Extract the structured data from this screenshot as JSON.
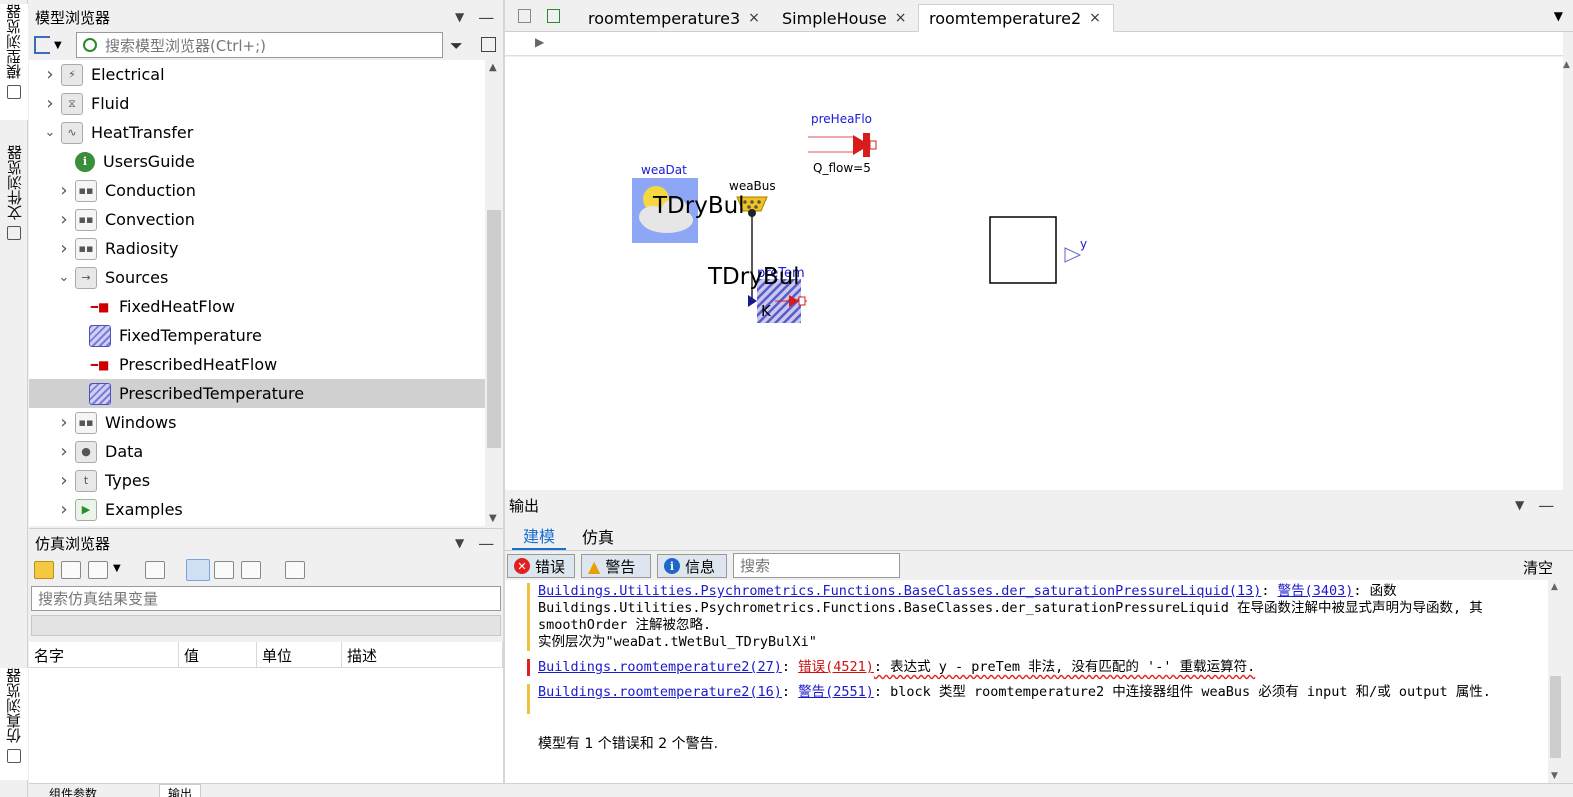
{
  "model_browser": {
    "title": "模型浏览器",
    "search_placeholder": "搜索模型浏览器(Ctrl+;)",
    "tree": [
      {
        "label": "Electrical",
        "depth": 0,
        "expanded": false,
        "icon": "electrical-icon"
      },
      {
        "label": "Fluid",
        "depth": 0,
        "expanded": false,
        "icon": "fluid-icon"
      },
      {
        "label": "HeatTransfer",
        "depth": 0,
        "expanded": true,
        "icon": "heattransfer-icon"
      },
      {
        "label": "UsersGuide",
        "depth": 1,
        "expanded": null,
        "icon": "info-icon"
      },
      {
        "label": "Conduction",
        "depth": 1,
        "expanded": false,
        "icon": "package-icon"
      },
      {
        "label": "Convection",
        "depth": 1,
        "expanded": false,
        "icon": "package-icon"
      },
      {
        "label": "Radiosity",
        "depth": 1,
        "expanded": false,
        "icon": "package-icon"
      },
      {
        "label": "Sources",
        "depth": 1,
        "expanded": true,
        "icon": "sources-icon"
      },
      {
        "label": "FixedHeatFlow",
        "depth": 2,
        "expanded": null,
        "icon": "heatflow-icon"
      },
      {
        "label": "FixedTemperature",
        "depth": 2,
        "expanded": null,
        "icon": "temperature-icon"
      },
      {
        "label": "PrescribedHeatFlow",
        "depth": 2,
        "expanded": null,
        "icon": "heatflow-icon"
      },
      {
        "label": "PrescribedTemperature",
        "depth": 2,
        "expanded": null,
        "icon": "temperature-icon",
        "selected": true
      },
      {
        "label": "Windows",
        "depth": 1,
        "expanded": false,
        "icon": "package-icon"
      },
      {
        "label": "Data",
        "depth": 1,
        "expanded": false,
        "icon": "data-icon"
      },
      {
        "label": "Types",
        "depth": 1,
        "expanded": false,
        "icon": "types-icon"
      },
      {
        "label": "Examples",
        "depth": 1,
        "expanded": false,
        "icon": "examples-icon"
      }
    ]
  },
  "side_tabs": {
    "model_browser": "模型浏览器",
    "file_browser": "文件浏览器",
    "sim_browser": "仿真浏览器"
  },
  "sim_browser": {
    "title": "仿真浏览器",
    "search_placeholder": "搜索仿真结果变量",
    "columns": [
      "名字",
      "值",
      "单位",
      "描述"
    ]
  },
  "editor": {
    "tabs": [
      {
        "label": "roomtemperature3",
        "close": "×",
        "active": false
      },
      {
        "label": "SimpleHouse",
        "close": "×",
        "active": false
      },
      {
        "label": "roomtemperature2",
        "close": "×",
        "active": true
      }
    ],
    "menu_icon": "▼"
  },
  "diagram": {
    "preHeaFlo_label": "preHeaFlo",
    "q_flow_label": "Q_flow=5",
    "weaDat_label": "weaDat",
    "weaBus_label": "weaBus",
    "tdrybul_overlay_1": "TDryBul",
    "tdrybul_overlay_2": "TDryBul",
    "preTem_label": "preTem",
    "k_label": "K",
    "y_label": "y"
  },
  "output": {
    "title": "输出",
    "tabs": [
      "建模",
      "仿真"
    ],
    "active_tab": "建模",
    "filters": {
      "error": "错误",
      "warning": "警告",
      "info": "信息"
    },
    "search_placeholder": "搜索",
    "clear": "清空",
    "entries": [
      {
        "type": "warning",
        "link": "Buildings.Utilities.Psychrometrics.Functions.BaseClasses.der_saturationPressureLiquid(13)",
        "code": "警告(3403)",
        "line1_tail": ": 函数",
        "line2": "Buildings.Utilities.Psychrometrics.Functions.BaseClasses.der_saturationPressureLiquid 在导函数注解中被显式声明为导函数, 其",
        "line3": "smoothOrder 注解被忽略.",
        "line4": "实例层次为\"weaDat.tWetBul_TDryBulXi\""
      },
      {
        "type": "error",
        "link": "Buildings.roomtemperature2(27)",
        "code": "错误(4521)",
        "text": ": 表达式 y - preTem 非法, 没有匹配的 '-' 重载运算符."
      },
      {
        "type": "warning",
        "link": "Buildings.roomtemperature2(16)",
        "code": "警告(2551)",
        "text": ": block 类型 roomtemperature2 中连接器组件 weaBus 必须有 input 和/或 output 属性."
      }
    ],
    "summary": "模型有 1 个错误和 2 个警告."
  },
  "status_tabs": [
    "组件参数",
    "输出"
  ]
}
